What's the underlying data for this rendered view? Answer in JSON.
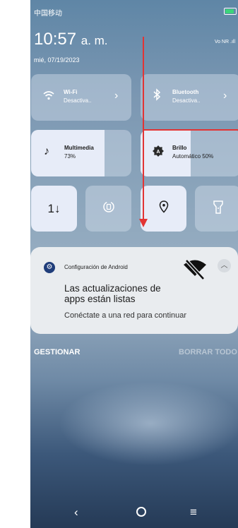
{
  "status_bar": {
    "carrier": "中国移动",
    "network": "Vo NR"
  },
  "clock": {
    "time": "10:57",
    "ampm": "a. m.",
    "date": "mié, 07/19/2023"
  },
  "tiles": {
    "wifi": {
      "label": "Wi-Fi",
      "state": "Desactiva.."
    },
    "bluetooth": {
      "label": "Bluetooth",
      "state": "Desactiva.."
    },
    "media": {
      "label": "Multimedia",
      "value": "73%",
      "level": 0.73
    },
    "brightness": {
      "label": "Brillo",
      "value": "Automático 50%",
      "level": 0.5
    },
    "icons": [
      "data-transfer-icon",
      "rotation-icon",
      "location-icon",
      "flashlight-icon"
    ]
  },
  "notification": {
    "app": "Configuración de Android",
    "title_line1": "Las actualizaciones de",
    "title_line2": "apps están listas",
    "body": "Conéctate a una red para continuar"
  },
  "actions": {
    "manage": "GESTIONAR",
    "clear_all": "BORRAR TODO"
  },
  "colors": {
    "tile_active": "#e7ecf8",
    "annotation_red": "#e23434",
    "app_icon": "#1f3d7a"
  }
}
